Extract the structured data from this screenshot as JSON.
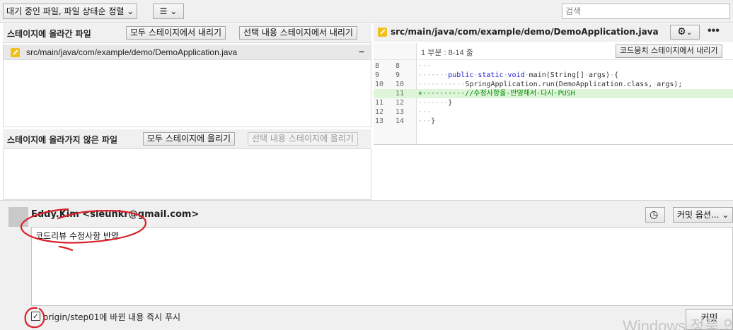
{
  "toolbar": {
    "sort_label": "대기 중인 파일, 파일 상태순 정렬",
    "search_placeholder": "검색"
  },
  "staged": {
    "title": "스테이지에 올라간 파일",
    "unstage_all_label": "모두 스테이지에서 내리기",
    "unstage_selected_label": "선택 내용 스테이지에서 내리기",
    "files": [
      {
        "path": "src/main/java/com/example/demo/DemoApplication.java",
        "icon": "modified-file-icon"
      }
    ]
  },
  "unstaged": {
    "title": "스테이지에 올라가지 않은 파일",
    "stage_all_label": "모두 스테이지에 올리기",
    "stage_selected_label": "선택 내용 스테이지에 올리기",
    "files": []
  },
  "diff": {
    "file_path": "src/main/java/com/example/demo/DemoApplication.java",
    "hunk_label": "1 부분 : 8-14 줄",
    "unstage_hunk_label": "코드뭉치 스테이지에서 내리기",
    "lines": [
      {
        "old": "8",
        "new": "8",
        "type": "context",
        "text": "···"
      },
      {
        "old": "9",
        "new": "9",
        "type": "context",
        "text": "·······public·static·void·main(String[]·args)·{"
      },
      {
        "old": "10",
        "new": "10",
        "type": "context",
        "text": "···········SpringApplication.run(DemoApplication.class,·args);"
      },
      {
        "old": "",
        "new": "11",
        "type": "added",
        "text": "+··········//수정사항을·반영해서·다시·PUSH"
      },
      {
        "old": "11",
        "new": "12",
        "type": "context",
        "text": "·······}"
      },
      {
        "old": "12",
        "new": "13",
        "type": "context",
        "text": "···"
      },
      {
        "old": "13",
        "new": "14",
        "type": "context",
        "text": "···}"
      }
    ]
  },
  "commit": {
    "author": "Eddy.Kim <sieunkr@gmail.com>",
    "message": "코드리뷰 수정사항 반영",
    "options_label": "커밋 옵션...",
    "push_label": "origin/step01에 바뀐 내용 즉시 푸시",
    "push_checked": true,
    "commit_label": "커밋",
    "watermark": "Windows 정품 인증"
  },
  "colors": {
    "accent_annotation": "#d8202a",
    "added_line_bg": "#dff5d9",
    "file_icon": "#f2c01a"
  }
}
